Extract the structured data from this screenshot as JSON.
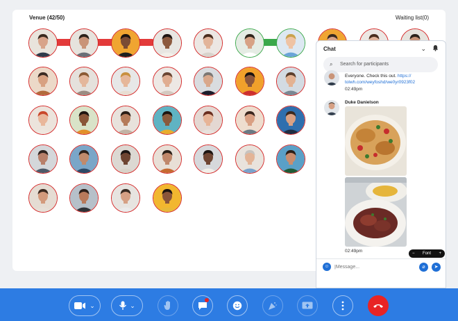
{
  "venue": {
    "title": "Venue (42/50)",
    "waiting_label": "Waiting list(0)"
  },
  "participants": [
    {
      "bg": "#e9e4dc",
      "skin": "#d8a48a",
      "hair": "#3a2a20",
      "shirt": "#2f3b4a"
    },
    {
      "bg": "#e6e3dd",
      "skin": "#c99478",
      "hair": "#2c221b",
      "shirt": "#6a6f77"
    },
    {
      "bg": "#f0a531",
      "skin": "#7a4b34",
      "hair": "#1a1310",
      "shirt": "#1f1f1f"
    },
    {
      "bg": "#e8e6e2",
      "skin": "#8c5a3f",
      "hair": "#1e1512",
      "shirt": "#f2efe9"
    },
    {
      "bg": "#ece7e3",
      "skin": "#e2b49a",
      "hair": "#4a2d1e",
      "shirt": "#d9d3cc"
    },
    {
      "bg": "#e5ece4",
      "skin": "#d7a285",
      "hair": "#2e241c",
      "shirt": "#ffffff"
    },
    {
      "bg": "#dde8f2",
      "skin": "#efc3a4",
      "hair": "#c9a24e",
      "shirt": "#6aa4d8"
    },
    {
      "bg": "#ecd9c8",
      "skin": "#d8a181",
      "hair": "#3b2b23",
      "shirt": "#b26a3b"
    },
    {
      "bg": "#e5e1dc",
      "skin": "#e4b79c",
      "hair": "#8b5a33",
      "shirt": "#9b8d83"
    },
    {
      "bg": "#e7e7e7",
      "skin": "#e6b79a",
      "hair": "#c8903f",
      "shirt": "#e8ddd2"
    },
    {
      "bg": "#ede8e4",
      "skin": "#e0ad91",
      "hair": "#6a4532",
      "shirt": "#d4c9c0"
    },
    {
      "bg": "#d9dcdf",
      "skin": "#d9a88b",
      "hair": "#7b7773",
      "shirt": "#1c1c2a"
    },
    {
      "bg": "#f1a12b",
      "skin": "#8d573b",
      "hair": "#1a1310",
      "shirt": "#cc2f2f"
    },
    {
      "bg": "#d3dbe2",
      "skin": "#e3b292",
      "hair": "#5c3f2c",
      "shirt": "#7a8894"
    },
    {
      "bg": "#ece4dc",
      "skin": "#e9b79b",
      "hair": "#c9482b",
      "shirt": "#efe7df"
    },
    {
      "bg": "#d9e3c8",
      "skin": "#8a5638",
      "hair": "#1f1510",
      "shirt": "#e2902a"
    },
    {
      "bg": "#e8e2dc",
      "skin": "#b57b5a",
      "hair": "#2a1d16",
      "shirt": "#c2b3a5"
    },
    {
      "bg": "#5fb3c3",
      "skin": "#8a5a3c",
      "hair": "#1d1511",
      "shirt": "#e9ad2c"
    },
    {
      "bg": "#e4d8d2",
      "skin": "#e7b497",
      "hair": "#6a2e1f",
      "shirt": "#e8e1dc"
    },
    {
      "bg": "#eeddce",
      "skin": "#d9a083",
      "hair": "#3a271e",
      "shirt": "#6b7a84"
    },
    {
      "bg": "#2f6fae",
      "skin": "#d9a184",
      "hair": "#3c2a20",
      "shirt": "#1f2e43"
    },
    {
      "bg": "#d4d7da",
      "skin": "#b8806a",
      "hair": "#2f2420",
      "shirt": "#4d5968"
    },
    {
      "bg": "#7aa6c8",
      "skin": "#c08a6c",
      "hair": "#2c201a",
      "shirt": "#2c4966"
    },
    {
      "bg": "#dcd8d2",
      "skin": "#6e4431",
      "hair": "#1b1412",
      "shirt": "#d9d2c8"
    },
    {
      "bg": "#e8dfd6",
      "skin": "#c0876a",
      "hair": "#2a1f18",
      "shirt": "#c66a31"
    },
    {
      "bg": "#d6d8db",
      "skin": "#6f4532",
      "hair": "#1c1411",
      "shirt": "#f2efe9"
    },
    {
      "bg": "#e9e3dc",
      "skin": "#e3b496",
      "hair": "#c7c3be",
      "shirt": "#7aa3cc"
    },
    {
      "bg": "#5aa0c7",
      "skin": "#c98d6e",
      "hair": "#2b1f18",
      "shirt": "#1f5a35"
    },
    {
      "bg": "#e5dcd3",
      "skin": "#d39a7c",
      "hair": "#3b2a20",
      "shirt": "#e6dfd7"
    },
    {
      "bg": "#b6c0c9",
      "skin": "#b97a5b",
      "hair": "#2d201a",
      "shirt": "#2e3237"
    },
    {
      "bg": "#e7e4e0",
      "skin": "#d6a084",
      "hair": "#3a2b22",
      "shirt": "#ebebeb"
    },
    {
      "bg": "#f2b72f",
      "skin": "#8a553a",
      "hair": "#1d1511",
      "shirt": "#e7b93a"
    }
  ],
  "waiting_avatars": [
    {
      "bg": "#f0a531",
      "skin": "#d8a48a",
      "hair": "#3a2a20",
      "shirt": "#1f3a5a"
    },
    {
      "bg": "#ece7e3",
      "skin": "#e2b49a",
      "hair": "#4a2d1e",
      "shirt": "#d9d3cc"
    },
    {
      "bg": "#e6e3dd",
      "skin": "#c99478",
      "hair": "#2c221b",
      "shirt": "#d33"
    }
  ],
  "chat": {
    "title": "Chat",
    "search_placeholder": "Search for participants",
    "prev_message_line1": "Everyone. Check this out.",
    "prev_message_link_part": "https://",
    "prev_message_link": "tolwh.com/weyfoshd/we0yr0923f02",
    "prev_time": "02:49pm",
    "sender": "Duke Danielson",
    "image_time": "02:49pm",
    "font_label": "Font",
    "font_minus": "−",
    "font_plus": "+",
    "input_placeholder": "|Message..."
  },
  "icons": {
    "chat_chevron": "chevron-down-icon",
    "bell": "bell-icon",
    "search": "search-icon",
    "camera": "video-camera-icon",
    "mic": "microphone-icon",
    "hand": "raise-hand-icon",
    "chat_bubble": "chat-bubble-icon",
    "emoji": "emoji-icon",
    "confetti": "party-icon",
    "share": "screen-share-icon",
    "more": "more-vertical-icon",
    "end": "end-call-icon"
  },
  "colors": {
    "toolbar": "#2d7ce3",
    "end_call": "#e82424",
    "tile_border": "#d32626",
    "pair_link": "#3aa84a",
    "accent": "#1f6fd6"
  }
}
